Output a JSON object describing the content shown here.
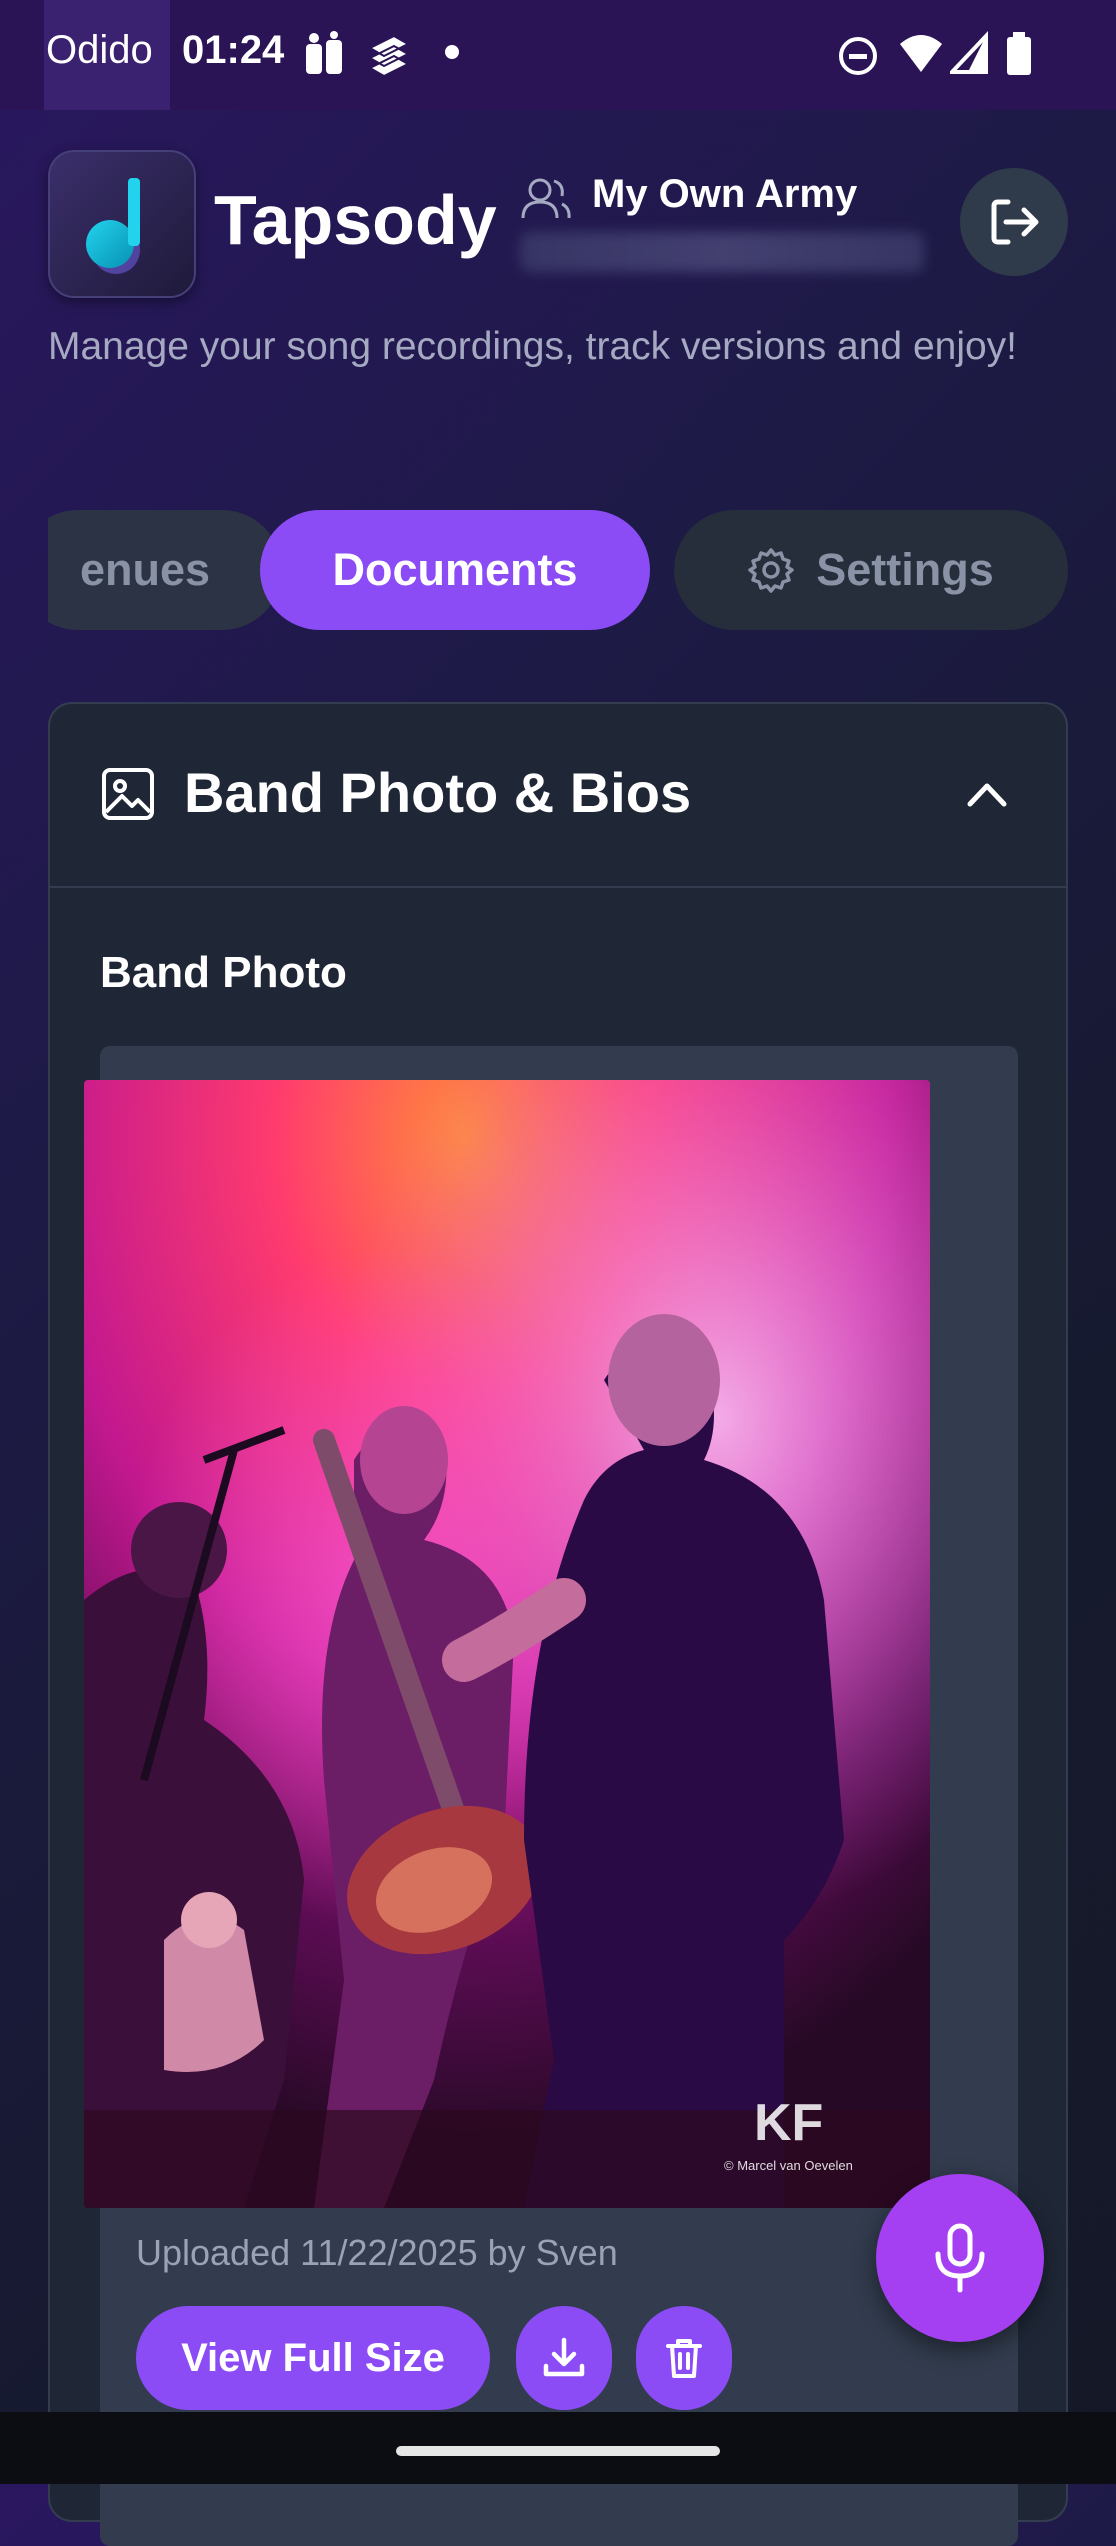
{
  "status_bar": {
    "carrier": "Odido",
    "time": "01:24"
  },
  "header": {
    "app_name": "Tapsody",
    "band_name": "My Own Army",
    "tagline": "Manage your song recordings, track versions and enjoy!"
  },
  "tabs": [
    {
      "label": "enues",
      "selected": false
    },
    {
      "label": "Documents",
      "selected": true
    },
    {
      "label": "Settings",
      "selected": false
    }
  ],
  "card": {
    "title": "Band Photo & Bios",
    "section_label": "Band Photo",
    "upload_meta": "Uploaded 11/22/2025 by Sven",
    "view_button": "View Full Size",
    "photo_credit": "© Marcel van Oevelen",
    "photo_watermark": "KF"
  },
  "colors": {
    "accent": "#8b4cf6",
    "fab": "#a43ff2",
    "card_bg": "#1f2737"
  },
  "icons": {
    "logout": "logout-icon",
    "download": "download-icon",
    "delete": "trash-icon",
    "mic": "microphone-icon",
    "settings": "gear-icon"
  }
}
